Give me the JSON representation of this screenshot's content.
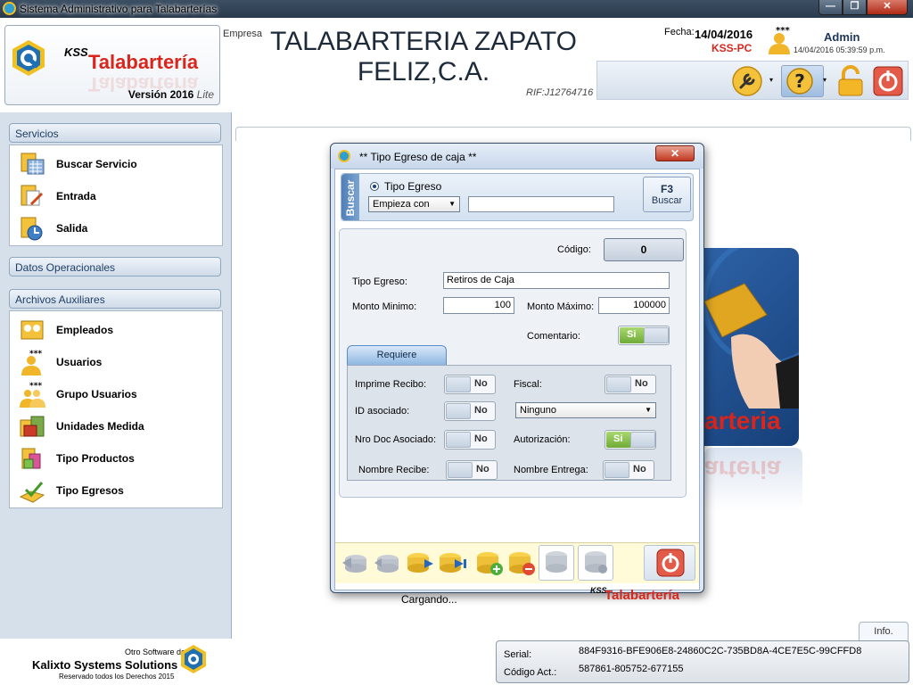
{
  "window": {
    "title": "Sistema Administrativo para Talabarterías",
    "minimize": "—",
    "maximize": "❐",
    "close": "✕"
  },
  "header": {
    "logo_kss": "KSS",
    "logo_name": "Talabartería",
    "version_label": "Versión 2016",
    "version_edition": "Lite",
    "empresa_label": "Empresa",
    "company_name": "TALABARTERIA ZAPATO FELIZ,C.A.",
    "rif": "RIF:J12764716",
    "fecha_label": "Fecha:",
    "fecha_value": "14/04/2016",
    "pc_name": "KSS-PC",
    "user_stars": "***",
    "user_name": "Admin",
    "timestamp": "14/04/2016  05:39:59 p.m."
  },
  "toolbar": {
    "icons": [
      "wrench-icon",
      "help-icon",
      "lock-icon",
      "power-icon"
    ],
    "caret": "▾"
  },
  "sidebar": {
    "groups": [
      {
        "label": "Servicios",
        "items": [
          {
            "label": "Buscar Servicio",
            "icon": "calendar-icon"
          },
          {
            "label": "Entrada",
            "icon": "entry-icon"
          },
          {
            "label": "Salida",
            "icon": "exit-icon"
          }
        ]
      },
      {
        "label": "Datos Operacionales",
        "items": []
      },
      {
        "label": "Archivos Auxiliares",
        "items": [
          {
            "label": "Empleados",
            "icon": "employees-icon"
          },
          {
            "label": "Usuarios",
            "icon": "user-icon",
            "stars": "***"
          },
          {
            "label": "Grupo Usuarios",
            "icon": "user-group-icon",
            "stars": "***"
          },
          {
            "label": "Unidades Medida",
            "icon": "units-icon"
          },
          {
            "label": "Tipo Productos",
            "icon": "products-icon"
          },
          {
            "label": "Tipo Egresos",
            "icon": "expenses-icon"
          }
        ]
      }
    ]
  },
  "footer": {
    "other_software": "Otro Software de",
    "vendor": "Kalixto Systems Solutions",
    "rights": "Reservado todos los Derechos 2015",
    "info_tab": "Info.",
    "serial_label": "Serial:",
    "serial_value": "884F9316-BFE906E8-24860C2C-735BD8A-4CE7E5C-99CFFD8",
    "code_label": "Código Act.:",
    "code_value": "587861-805752-677155"
  },
  "background_logo": {
    "text": "arteria"
  },
  "dialog": {
    "title": "** Tipo Egreso de caja **",
    "close": "✕",
    "search": {
      "tab_label": "Buscar",
      "radio_label": "Tipo Egreso",
      "mode": "Empieza con",
      "query": "",
      "f3_key": "F3",
      "f3_label": "Buscar"
    },
    "form": {
      "codigo_label": "Código:",
      "codigo_value": "0",
      "tipo_label": "Tipo Egreso:",
      "tipo_value": "Retiros de Caja",
      "min_label": "Monto Minimo:",
      "min_value": "100",
      "max_label": "Monto Máximo:",
      "max_value": "100000",
      "comentario_label": "Comentario:",
      "comentario_value": "Si"
    },
    "requiere": {
      "tab_label": "Requiere",
      "imprime_label": "Imprime Recibo:",
      "imprime_value": "No",
      "fiscal_label": "Fiscal:",
      "fiscal_value": "No",
      "id_label": "ID asociado:",
      "id_value": "No",
      "ninguno_value": "Ninguno",
      "nrodoc_label": "Nro Doc Asociado:",
      "nrodoc_value": "No",
      "autorizacion_label": "Autorización:",
      "autorizacion_value": "Si",
      "nombre_recibe_label": "Nombre Recibe:",
      "nombre_recibe_value": "No",
      "nombre_entrega_label": "Nombre Entrega:",
      "nombre_entrega_value": "No"
    },
    "status": "Cargando...",
    "brand_kss": "KSS",
    "brand_name": "Talabartería"
  }
}
